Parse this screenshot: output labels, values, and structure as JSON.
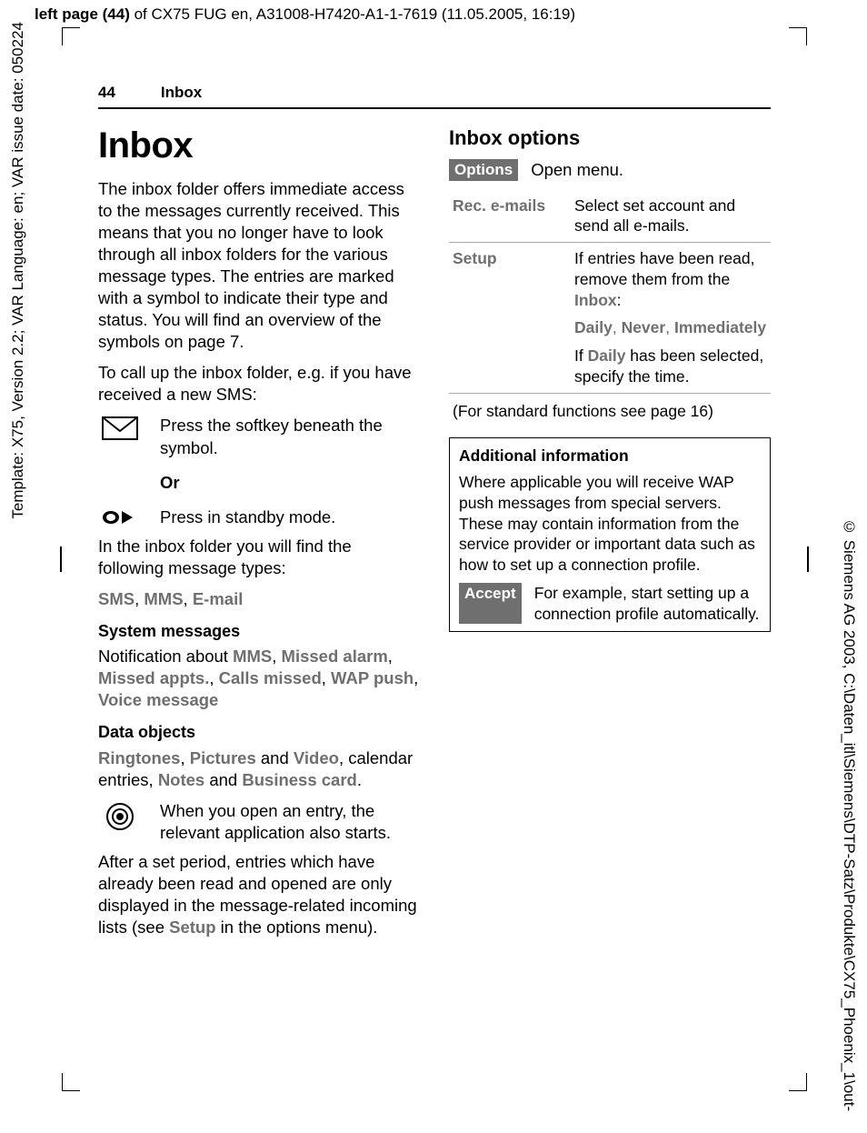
{
  "topbar": {
    "pagepos": "left page (44)",
    "of": " of CX75 FUG en, A31008-H7420-A1-1-7619 (11.05.2005, 16:19)"
  },
  "leftvert": "Template: X75, Version 2.2; VAR Language: en; VAR issue date: 050224",
  "rightvert": "© Siemens AG 2003, C:\\Daten_itl\\Siemens\\DTP-Satz\\Produkte\\CX75_Phoenix_1\\out-",
  "runhead": {
    "num": "44",
    "title": "Inbox"
  },
  "left": {
    "h1": "Inbox",
    "p1": "The inbox folder offers immediate access to the messages currently received. This means that you no longer have to look through all inbox folders for the various message types. The entries are marked with a symbol to indicate their type and status. You will find an overview of the symbols on page 7.",
    "p2": "To call up the inbox folder, e.g. if you have received a new SMS:",
    "i1": "Press the softkey beneath the symbol.",
    "or": "Or",
    "i2": "Press in standby mode.",
    "p3": "In the inbox folder you will find the following message types:",
    "types": {
      "sms": "SMS",
      "mms": "MMS",
      "email": "E-mail"
    },
    "h3a": "System messages",
    "sys_pre": "Notification about ",
    "sys_items": {
      "mms": "MMS",
      "missed_alarm": "Missed alarm",
      "missed_appts": "Missed appts.",
      "calls_missed": "Calls missed",
      "wap_push": "WAP push",
      "voice_message": "Voice message"
    },
    "h3b": "Data objects",
    "data_items": {
      "ringtones": "Ringtones",
      "pictures": "Pictures",
      "video": "Video",
      "notes": "Notes",
      "bcard": "Business card"
    },
    "data_mid": ", calendar entries, ",
    "data_and": " and ",
    "i3": "When you open an entry, the relevant application also starts.",
    "p4a": "After a set period, entries which have already been read and opened are only displayed in the message-related incoming lists (see ",
    "setup": "Setup",
    "p4b": " in the options menu)."
  },
  "right": {
    "h2": "Inbox options",
    "options_btn": "Options",
    "openmenu": "Open menu.",
    "row1": {
      "k": "Rec. e-mails",
      "v": "Select set account and send all e-mails."
    },
    "row2": {
      "k": "Setup",
      "v1a": "If entries have been read, remove them from the ",
      "inbox": "Inbox",
      "v1b": ":",
      "v2": {
        "daily": "Daily",
        "never": "Never",
        "immediately": "Immediately"
      },
      "v3a": "If ",
      "v3daily": "Daily",
      "v3b": " has been selected, specify the time."
    },
    "stdfn": "(For standard functions see page 16)",
    "info": {
      "title": "Additional information",
      "p": "Where applicable you will receive WAP push messages from special servers. These may contain information from the service provider or important data such as how to set up a connection profile.",
      "accept": "Accept",
      "accept_txt": "For example, start setting up a connection profile automatically."
    }
  }
}
